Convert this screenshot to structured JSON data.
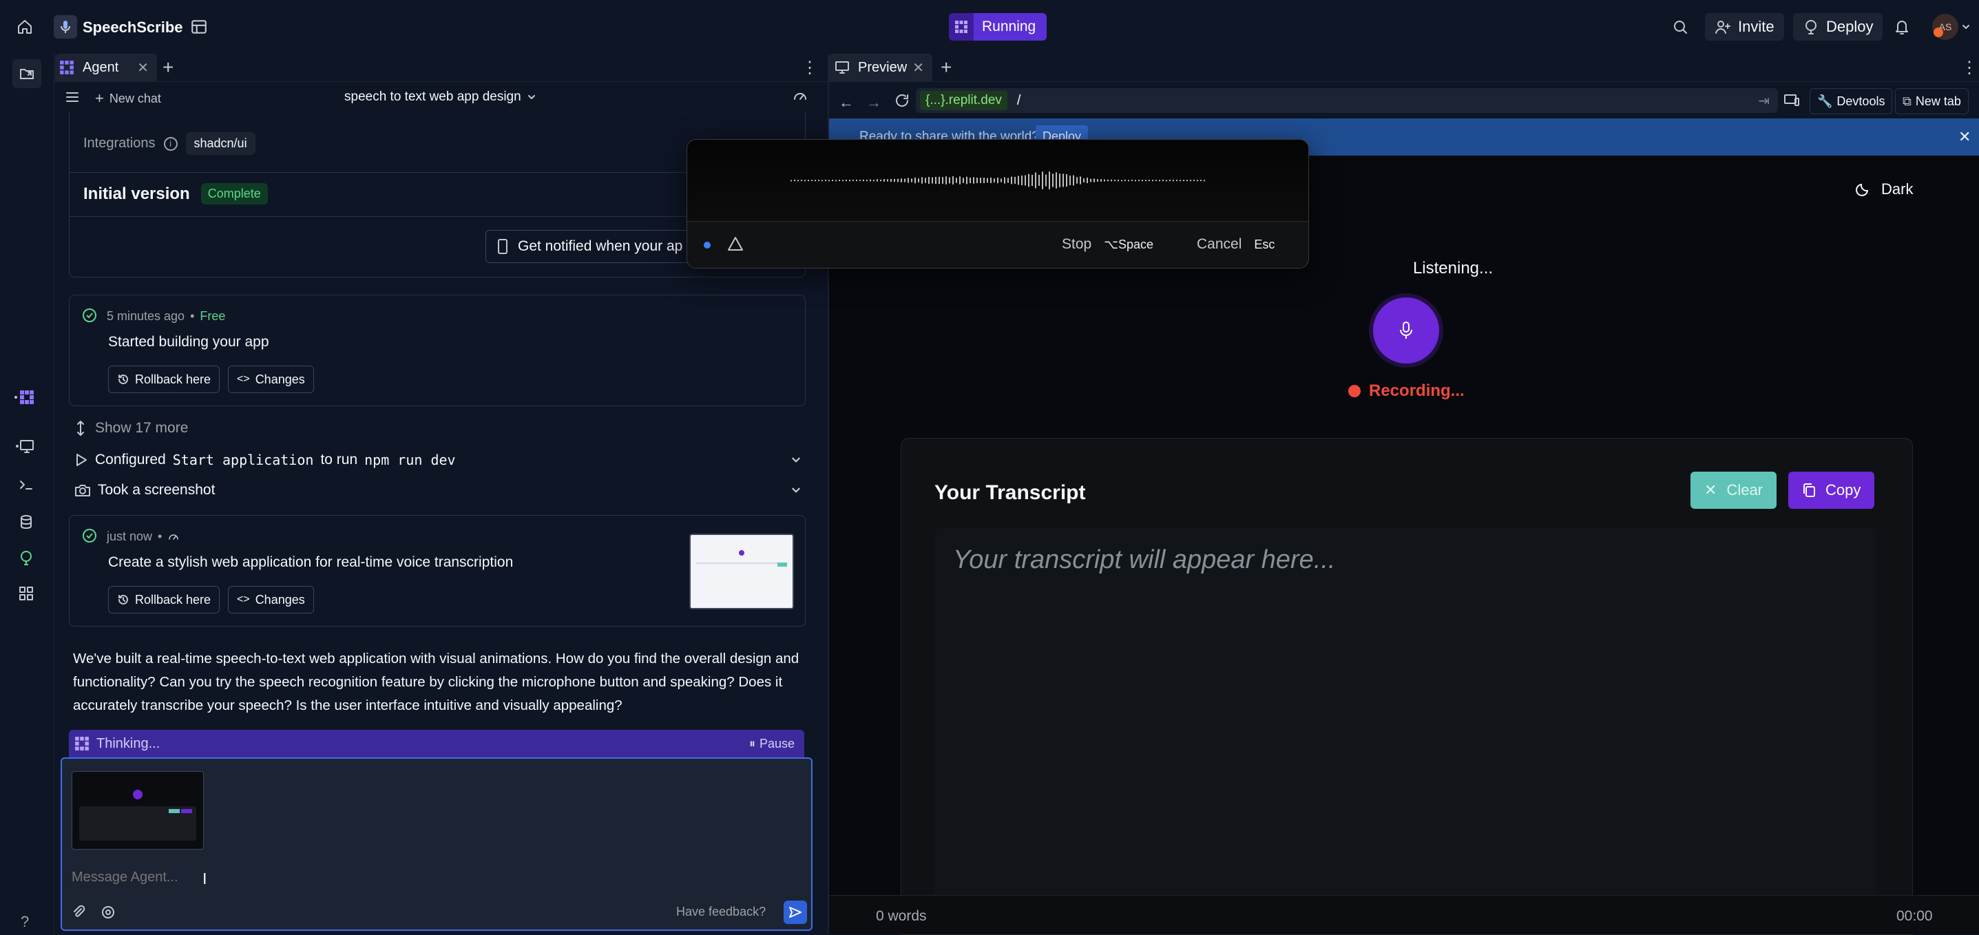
{
  "topbar": {
    "app_name": "SpeechScribe",
    "status": "Running",
    "invite": "Invite",
    "deploy": "Deploy",
    "avatar": "AS"
  },
  "agent": {
    "tab_label": "Agent",
    "new_chat": "New chat",
    "chat_title": "speech to text web app design",
    "integrations_label": "Integrations",
    "integration_item": "shadcn/ui",
    "initial_version": "Initial version",
    "complete_badge": "Complete",
    "notify_btn": "Get notified when your ap",
    "checkpoint1": {
      "time": "5 minutes ago",
      "dot": "•",
      "price": "Free",
      "text": "Started building your app",
      "rollback": "Rollback here",
      "changes": "Changes"
    },
    "show_more": "Show 17 more",
    "configured": {
      "a": "Configured",
      "code1": "Start application",
      "b": "to run",
      "code2": "npm run dev"
    },
    "screenshot": "Took a screenshot",
    "checkpoint2": {
      "time": "just now",
      "dot": "•",
      "text": "Create a stylish web application for real-time voice transcription",
      "rollback": "Rollback here",
      "changes": "Changes"
    },
    "message": "We've built a real-time speech-to-text web application with visual animations. How do you find the overall design and functionality? Can you try the speech recognition feature by clicking the microphone button and speaking? Does it accurately transcribe your speech? Is the user interface intuitive and visually appealing?",
    "thinking": "Thinking...",
    "pause": "Pause",
    "composer_placeholder": "Message Agent...",
    "feedback": "Have feedback?"
  },
  "preview": {
    "tab_label": "Preview",
    "url_domain": "{...}.replit.dev",
    "url_path": "/",
    "devtools": "Devtools",
    "new_tab": "New tab",
    "banner_text": "Ready to share with the world?",
    "banner_button": "Deploy"
  },
  "overlay": {
    "stop": "Stop",
    "stop_key": "⌥Space",
    "cancel": "Cancel",
    "cancel_key": "Esc"
  },
  "app": {
    "theme_toggle": "Dark",
    "listening": "Listening...",
    "recording": "Recording...",
    "transcript_title": "Your Transcript",
    "clear": "Clear",
    "copy": "Copy",
    "placeholder": "Your transcript will appear here...",
    "word_count": "0 words",
    "timer": "00:00"
  },
  "colors": {
    "accent_purple": "#6d28d9",
    "recording_red": "#ef4a3c",
    "clear_teal": "#5fc3b7",
    "banner_blue": "#1f4d91"
  }
}
